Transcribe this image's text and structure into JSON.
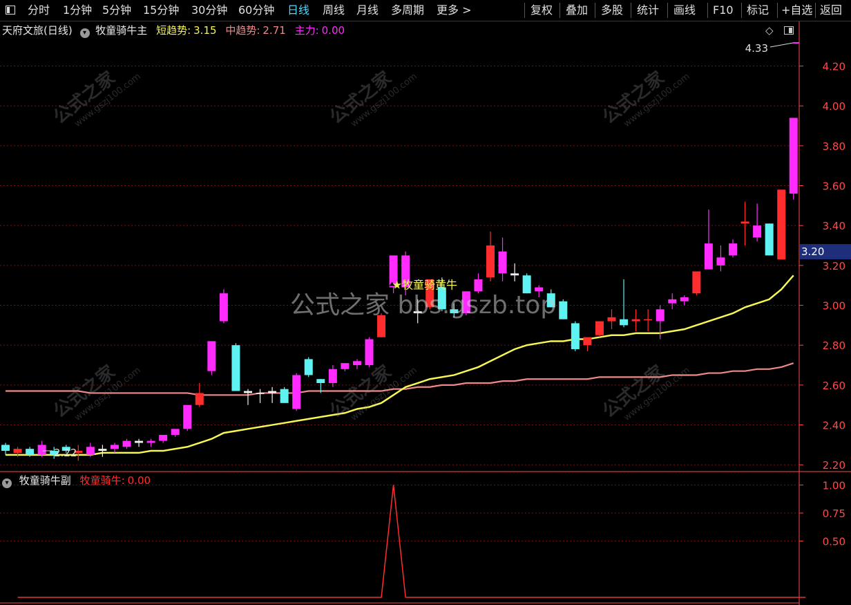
{
  "toolbar": {
    "left": [
      "分时",
      "1分钟",
      "5分钟",
      "15分钟",
      "30分钟",
      "60分钟",
      "日线",
      "周线",
      "月线",
      "多周期",
      "更多 >"
    ],
    "active": "日线",
    "right": [
      "复权",
      "叠加",
      "多股",
      "统计",
      "画线",
      "F10",
      "标记",
      "+自选",
      "返回"
    ]
  },
  "main_header": {
    "stock": "天府文旅(日线)",
    "indicator": "牧童骑牛主",
    "short_label": "短趋势:",
    "short_value": "3.15",
    "mid_label": "中趋势:",
    "mid_value": "2.71",
    "main_label": "主力:",
    "main_value": "0.00"
  },
  "sub_header": {
    "indicator": "牧童骑牛副",
    "signal_label": "牧童骑牛:",
    "signal_value": "0.00"
  },
  "signal_text": "★牧童骑黄牛",
  "current_price": "3.20",
  "high_marker": "4.33",
  "low_marker": "2.22",
  "watermark_text": "公式之家",
  "watermark_url": "www.gszj100.com",
  "center_watermark": "公式之家 bbs.gszb.top",
  "colors": {
    "up": "#ff2d2d",
    "down": "#5ff2f2",
    "magenta": "#ff2bff",
    "short_trend": "#f6f655",
    "mid_trend": "#f08a8a",
    "grid": "#7a1010",
    "axis_text": "#ff4a4a"
  },
  "chart_data": [
    {
      "type": "candlestick",
      "name": "main",
      "y_ticks": [
        "4.20",
        "4.00",
        "3.80",
        "3.60",
        "3.40",
        "3.20",
        "3.00",
        "2.80",
        "2.60",
        "2.40",
        "2.20"
      ],
      "ylim": [
        2.18,
        4.33
      ],
      "candles": [
        {
          "o": 2.3,
          "h": 2.31,
          "l": 2.25,
          "c": 2.27,
          "col": "c"
        },
        {
          "o": 2.26,
          "h": 2.29,
          "l": 2.24,
          "c": 2.28,
          "col": "r"
        },
        {
          "o": 2.28,
          "h": 2.29,
          "l": 2.24,
          "c": 2.25,
          "col": "c"
        },
        {
          "o": 2.25,
          "h": 2.32,
          "l": 2.24,
          "c": 2.3,
          "col": "m"
        },
        {
          "o": 2.27,
          "h": 2.29,
          "l": 2.23,
          "c": 2.25,
          "col": "c"
        },
        {
          "o": 2.29,
          "h": 2.3,
          "l": 2.26,
          "c": 2.27,
          "col": "c"
        },
        {
          "o": 2.26,
          "h": 2.3,
          "l": 2.22,
          "c": 2.27,
          "col": "r"
        },
        {
          "o": 2.25,
          "h": 2.31,
          "l": 2.24,
          "c": 2.29,
          "col": "m"
        },
        {
          "o": 2.27,
          "h": 2.3,
          "l": 2.24,
          "c": 2.28,
          "col": "w"
        },
        {
          "o": 2.28,
          "h": 2.31,
          "l": 2.26,
          "c": 2.3,
          "col": "m"
        },
        {
          "o": 2.29,
          "h": 2.33,
          "l": 2.28,
          "c": 2.32,
          "col": "m"
        },
        {
          "o": 2.31,
          "h": 2.33,
          "l": 2.29,
          "c": 2.32,
          "col": "w"
        },
        {
          "o": 2.31,
          "h": 2.33,
          "l": 2.29,
          "c": 2.32,
          "col": "m"
        },
        {
          "o": 2.32,
          "h": 2.35,
          "l": 2.31,
          "c": 2.35,
          "col": "m"
        },
        {
          "o": 2.35,
          "h": 2.38,
          "l": 2.34,
          "c": 2.38,
          "col": "m"
        },
        {
          "o": 2.38,
          "h": 2.5,
          "l": 2.37,
          "c": 2.5,
          "col": "m"
        },
        {
          "o": 2.5,
          "h": 2.61,
          "l": 2.49,
          "c": 2.56,
          "col": "r"
        },
        {
          "o": 2.67,
          "h": 2.82,
          "l": 2.65,
          "c": 2.82,
          "col": "m"
        },
        {
          "o": 2.92,
          "h": 3.08,
          "l": 2.91,
          "c": 3.06,
          "col": "m"
        },
        {
          "o": 2.8,
          "h": 2.81,
          "l": 2.57,
          "c": 2.57,
          "col": "c"
        },
        {
          "o": 2.57,
          "h": 2.58,
          "l": 2.5,
          "c": 2.56,
          "col": "w"
        },
        {
          "o": 2.56,
          "h": 2.58,
          "l": 2.51,
          "c": 2.56,
          "col": "w"
        },
        {
          "o": 2.56,
          "h": 2.59,
          "l": 2.51,
          "c": 2.57,
          "col": "w"
        },
        {
          "o": 2.58,
          "h": 2.59,
          "l": 2.51,
          "c": 2.51,
          "col": "c"
        },
        {
          "o": 2.48,
          "h": 2.66,
          "l": 2.47,
          "c": 2.65,
          "col": "m"
        },
        {
          "o": 2.73,
          "h": 2.74,
          "l": 2.64,
          "c": 2.65,
          "col": "c"
        },
        {
          "o": 2.61,
          "h": 2.63,
          "l": 2.56,
          "c": 2.63,
          "col": "c"
        },
        {
          "o": 2.61,
          "h": 2.7,
          "l": 2.59,
          "c": 2.68,
          "col": "m"
        },
        {
          "o": 2.68,
          "h": 2.71,
          "l": 2.67,
          "c": 2.71,
          "col": "m"
        },
        {
          "o": 2.7,
          "h": 2.73,
          "l": 2.68,
          "c": 2.72,
          "col": "m"
        },
        {
          "o": 2.7,
          "h": 2.84,
          "l": 2.69,
          "c": 2.83,
          "col": "m"
        },
        {
          "o": 2.84,
          "h": 2.96,
          "l": 2.84,
          "c": 2.95,
          "col": "r"
        },
        {
          "o": 3.09,
          "h": 3.25,
          "l": 3.06,
          "c": 3.25,
          "col": "m"
        },
        {
          "o": 3.25,
          "h": 3.27,
          "l": 3.05,
          "c": 3.09,
          "col": "m"
        },
        {
          "o": 2.96,
          "h": 3.03,
          "l": 2.91,
          "c": 2.97,
          "col": "w"
        },
        {
          "o": 2.99,
          "h": 3.13,
          "l": 2.98,
          "c": 3.13,
          "col": "r"
        },
        {
          "o": 3.09,
          "h": 3.14,
          "l": 2.97,
          "c": 2.98,
          "col": "c"
        },
        {
          "o": 2.98,
          "h": 3.01,
          "l": 2.94,
          "c": 2.96,
          "col": "c"
        },
        {
          "o": 2.96,
          "h": 3.07,
          "l": 2.95,
          "c": 3.07,
          "col": "m"
        },
        {
          "o": 3.07,
          "h": 3.16,
          "l": 3.06,
          "c": 3.13,
          "col": "m"
        },
        {
          "o": 3.14,
          "h": 3.37,
          "l": 3.12,
          "c": 3.3,
          "col": "r"
        },
        {
          "o": 3.27,
          "h": 3.34,
          "l": 3.12,
          "c": 3.16,
          "col": "m"
        },
        {
          "o": 3.16,
          "h": 3.21,
          "l": 3.12,
          "c": 3.15,
          "col": "w"
        },
        {
          "o": 3.15,
          "h": 3.16,
          "l": 3.06,
          "c": 3.06,
          "col": "c"
        },
        {
          "o": 3.07,
          "h": 3.1,
          "l": 3.04,
          "c": 3.09,
          "col": "m"
        },
        {
          "o": 3.06,
          "h": 3.08,
          "l": 2.99,
          "c": 2.99,
          "col": "c"
        },
        {
          "o": 3.02,
          "h": 3.03,
          "l": 2.93,
          "c": 2.93,
          "col": "c"
        },
        {
          "o": 2.91,
          "h": 2.92,
          "l": 2.77,
          "c": 2.78,
          "col": "c"
        },
        {
          "o": 2.8,
          "h": 2.84,
          "l": 2.77,
          "c": 2.84,
          "col": "r"
        },
        {
          "o": 2.85,
          "h": 2.92,
          "l": 2.84,
          "c": 2.92,
          "col": "r"
        },
        {
          "o": 2.94,
          "h": 2.98,
          "l": 2.88,
          "c": 2.92,
          "col": "r"
        },
        {
          "o": 2.93,
          "h": 3.13,
          "l": 2.89,
          "c": 2.9,
          "col": "c"
        },
        {
          "o": 2.92,
          "h": 2.98,
          "l": 2.87,
          "c": 2.93,
          "col": "r"
        },
        {
          "o": 2.93,
          "h": 2.98,
          "l": 2.87,
          "c": 2.93,
          "col": "r"
        },
        {
          "o": 2.92,
          "h": 3.0,
          "l": 2.83,
          "c": 2.98,
          "col": "m"
        },
        {
          "o": 3.01,
          "h": 3.06,
          "l": 2.98,
          "c": 3.03,
          "col": "m"
        },
        {
          "o": 3.02,
          "h": 3.05,
          "l": 3.0,
          "c": 3.04,
          "col": "m"
        },
        {
          "o": 3.06,
          "h": 3.17,
          "l": 3.05,
          "c": 3.17,
          "col": "r"
        },
        {
          "o": 3.18,
          "h": 3.48,
          "l": 3.18,
          "c": 3.31,
          "col": "m"
        },
        {
          "o": 3.2,
          "h": 3.3,
          "l": 3.17,
          "c": 3.24,
          "col": "m"
        },
        {
          "o": 3.25,
          "h": 3.33,
          "l": 3.24,
          "c": 3.31,
          "col": "m"
        },
        {
          "o": 3.41,
          "h": 3.52,
          "l": 3.3,
          "c": 3.42,
          "col": "r"
        },
        {
          "o": 3.34,
          "h": 3.51,
          "l": 3.32,
          "c": 3.4,
          "col": "m"
        },
        {
          "o": 3.41,
          "h": 3.41,
          "l": 3.25,
          "c": 3.25,
          "col": "c"
        },
        {
          "o": 3.23,
          "h": 3.58,
          "l": 3.23,
          "c": 3.58,
          "col": "r"
        },
        {
          "o": 3.56,
          "h": 3.94,
          "l": 3.53,
          "c": 3.94,
          "col": "m"
        }
      ],
      "short_trend": [
        2.25,
        2.25,
        2.25,
        2.25,
        2.25,
        2.25,
        2.25,
        2.25,
        2.26,
        2.26,
        2.26,
        2.26,
        2.27,
        2.27,
        2.28,
        2.29,
        2.31,
        2.33,
        2.36,
        2.37,
        2.38,
        2.39,
        2.4,
        2.41,
        2.42,
        2.43,
        2.44,
        2.45,
        2.46,
        2.48,
        2.49,
        2.51,
        2.55,
        2.59,
        2.61,
        2.63,
        2.64,
        2.65,
        2.67,
        2.69,
        2.72,
        2.75,
        2.78,
        2.8,
        2.81,
        2.82,
        2.82,
        2.83,
        2.83,
        2.84,
        2.85,
        2.85,
        2.86,
        2.86,
        2.86,
        2.87,
        2.88,
        2.9,
        2.92,
        2.94,
        2.96,
        2.99,
        3.01,
        3.03,
        3.08,
        3.15
      ],
      "mid_trend": [
        2.57,
        2.57,
        2.57,
        2.57,
        2.57,
        2.57,
        2.57,
        2.56,
        2.56,
        2.56,
        2.56,
        2.56,
        2.56,
        2.56,
        2.56,
        2.56,
        2.55,
        2.55,
        2.55,
        2.55,
        2.55,
        2.56,
        2.56,
        2.56,
        2.56,
        2.57,
        2.57,
        2.57,
        2.57,
        2.57,
        2.57,
        2.57,
        2.58,
        2.58,
        2.59,
        2.59,
        2.6,
        2.6,
        2.61,
        2.61,
        2.61,
        2.62,
        2.62,
        2.63,
        2.63,
        2.63,
        2.63,
        2.63,
        2.63,
        2.64,
        2.64,
        2.64,
        2.64,
        2.64,
        2.64,
        2.65,
        2.65,
        2.65,
        2.66,
        2.66,
        2.67,
        2.67,
        2.68,
        2.68,
        2.69,
        2.71
      ],
      "signal_index": 32
    },
    {
      "type": "line",
      "name": "sub",
      "y_ticks": [
        "1.00",
        "0.75",
        "0.50"
      ],
      "ylim": [
        -0.05,
        1.07
      ],
      "values": [
        0,
        0,
        0,
        0,
        0,
        0,
        0,
        0,
        0,
        0,
        0,
        0,
        0,
        0,
        0,
        0,
        0,
        0,
        0,
        0,
        0,
        0,
        0,
        0,
        0,
        0,
        0,
        0,
        0,
        0,
        0,
        1,
        0,
        0,
        0,
        0,
        0,
        0,
        0,
        0,
        0,
        0,
        0,
        0,
        0,
        0,
        0,
        0,
        0,
        0,
        0,
        0,
        0,
        0,
        0,
        0,
        0,
        0,
        0,
        0,
        0,
        0,
        0,
        0,
        0,
        0
      ]
    }
  ]
}
